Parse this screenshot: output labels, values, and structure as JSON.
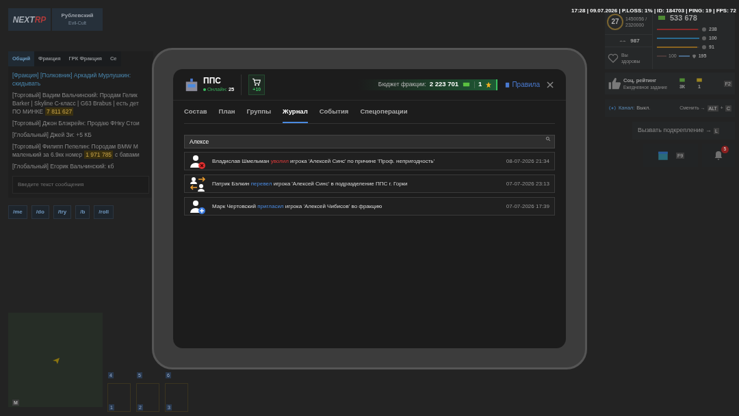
{
  "status_line": "17:28 | 09.07.2026 | P.LOSS: 1% | ID: 184703 | PING: 19 | FPS: 72",
  "logo": {
    "part_1": "NEXT",
    "part_2": "RP"
  },
  "server": {
    "name": "Рублевский",
    "subtitle": "Evil-Cult"
  },
  "chat": {
    "tabs": [
      {
        "label": "Общий",
        "selected": true
      },
      {
        "label": "Фракция",
        "selected": false
      },
      {
        "label": "ГРК Фракция",
        "selected": false
      },
      {
        "label": "Се",
        "selected": false
      }
    ],
    "messages": [
      {
        "kind": "faction",
        "lines": [
          [
            {
              "kind": "plain",
              "text": "[Фракция] [Полковник] Аркадий Мурлушкин:"
            }
          ],
          [
            {
              "kind": "plain",
              "text": "скидывать"
            }
          ]
        ]
      },
      {
        "kind": "normal",
        "lines": [
          [
            {
              "kind": "plain",
              "text": "[Торговый] Вадим Вальчинский: Продам Гелик"
            }
          ],
          [
            {
              "kind": "plain",
              "text": "Barker | Skyline C-класс | G63 Brabus | есть дет"
            }
          ],
          [
            {
              "kind": "plain",
              "text": "ПО МИНКЕ"
            },
            {
              "kind": "price",
              "text": "7 811 627"
            }
          ]
        ]
      },
      {
        "kind": "normal",
        "lines": [
          [
            {
              "kind": "plain",
              "text": "[Торговый] Джон Блэкрейн: Продаю ФНку Стои"
            }
          ]
        ]
      },
      {
        "kind": "normal",
        "lines": [
          [
            {
              "kind": "plain",
              "text": "[Глобальный] Джей Зи: +5 КБ"
            }
          ]
        ]
      },
      {
        "kind": "normal",
        "lines": [
          [
            {
              "kind": "plain",
              "text": "[Торговый] Филипп Пепелин: Породам BMW M"
            }
          ],
          [
            {
              "kind": "plain",
              "text": "маленький за 6.9кк номер"
            },
            {
              "kind": "price",
              "text": "1 971 785"
            },
            {
              "kind": "plain",
              "text": "с бавами"
            }
          ]
        ]
      },
      {
        "kind": "normal",
        "lines": [
          [
            {
              "kind": "plain",
              "text": "[Глобальный] Егорик Вальчинский: кб"
            }
          ]
        ]
      }
    ],
    "input": {
      "placeholder": "Введите текст сообщения"
    },
    "commands": [
      "/me",
      "/do",
      "/try",
      "/b",
      "/roll"
    ]
  },
  "hud": {
    "level": "27",
    "xp_current": "1450056 /",
    "xp_total": "2320000",
    "reputation": "987",
    "health_status": "Вы здоровы",
    "money": "533 678",
    "stats": [
      {
        "kind": "health",
        "level": 0.97,
        "reading": "238"
      },
      {
        "kind": "energy",
        "level": 1.0,
        "reading": "100"
      },
      {
        "kind": "food",
        "level": 0.95,
        "reading": "91"
      }
    ],
    "oxygen": "100",
    "armor": "195"
  },
  "social_rating": {
    "title": "Соц. рейтинг",
    "subtitle": "Ежедневное задание",
    "reward_money": "3К",
    "reward_tickets": "1",
    "hotkey": "F2"
  },
  "radio": {
    "label": "Канал:",
    "value": "Выкл.",
    "switch_label": "Сменить →",
    "keys": [
      "ALT",
      "+",
      "C"
    ]
  },
  "backup": {
    "label": "Вызвать подкрепление →",
    "hotkey": "L"
  },
  "calendar_hotkey": "F9",
  "notifications_count": "5",
  "minimap": {
    "hotkey": "M"
  },
  "hotbar": [
    "4",
    "5",
    "6",
    "1",
    "2",
    "3"
  ],
  "tablet": {
    "faction": "ППС",
    "online_label": "Онлайн:",
    "online_count": "25",
    "shop_badge": "+10",
    "budget_label": "Бюджет фракции:",
    "budget_value": "2 223 701",
    "stars": "1",
    "rules": "Правила",
    "tabs": [
      {
        "label": "Состав",
        "selected": false
      },
      {
        "label": "План",
        "selected": false
      },
      {
        "label": "Группы",
        "selected": false
      },
      {
        "label": "Журнал",
        "selected": true
      },
      {
        "label": "События",
        "selected": false
      },
      {
        "label": "Спецоперации",
        "selected": false
      }
    ],
    "search": {
      "value": "Алексе"
    },
    "log": [
      {
        "kind": "fired",
        "actor": "Владислав Шмельман",
        "action": "уволил",
        "rest": "игрока 'Алексей Синс' по причине 'Проф. непригодность'",
        "time": "08-07-2026 21:34"
      },
      {
        "kind": "transferred",
        "actor": "Патрик Бэлкин",
        "action": "перевел",
        "rest": "игрока 'Алексей Синс' в подразделение ППС г. Горки",
        "time": "07-07-2026 23:13"
      },
      {
        "kind": "invited",
        "actor": "Марк Чертовский",
        "action": "пригласил",
        "rest": "игрока 'Алексей Чибисов' во фракцию",
        "time": "07-07-2026 17:39"
      }
    ]
  }
}
